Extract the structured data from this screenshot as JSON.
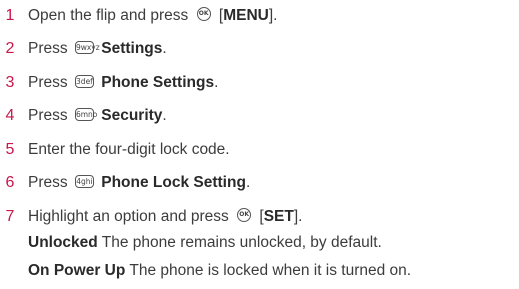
{
  "steps": [
    {
      "num": "1",
      "pre": "Open the flip and press",
      "key_icon": "ok-button-icon",
      "key_label": "OK",
      "bracket_open": "[",
      "bold": "MENU",
      "post": "]."
    },
    {
      "num": "2",
      "pre": "Press",
      "key_label": "9wxyz",
      "bold": "Settings",
      "post": "."
    },
    {
      "num": "3",
      "pre": "Press",
      "key_label": "3def",
      "bold": "Phone Settings",
      "post": "."
    },
    {
      "num": "4",
      "pre": "Press",
      "key_label": "6mno",
      "bold": "Security",
      "post": "."
    },
    {
      "num": "5",
      "text": "Enter the four-digit lock code."
    },
    {
      "num": "6",
      "pre": "Press",
      "key_label": "4ghi",
      "bold": "Phone Lock Setting",
      "post": "."
    },
    {
      "num": "7",
      "pre": "Highlight an option and press",
      "key_icon": "ok-button-icon",
      "key_label": "OK",
      "bracket_open": "[",
      "bold": "SET",
      "post": "]."
    }
  ],
  "options": [
    {
      "term": "Unlocked",
      "desc": " The phone remains unlocked, by default."
    },
    {
      "term": "On Power Up",
      "desc": " The phone is locked when it is turned on."
    }
  ]
}
